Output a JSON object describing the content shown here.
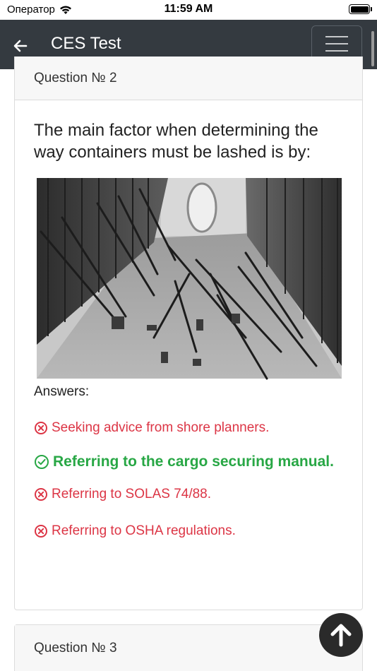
{
  "status_bar": {
    "carrier": "Оператор",
    "time": "11:59 AM"
  },
  "navbar": {
    "title": "CES Test"
  },
  "question": {
    "header": "Question № 2",
    "text": "The main factor when determining the way containers must be lashed is by:",
    "answers_label": "Answers:",
    "answers": [
      {
        "text": "Seeking advice from shore planners.",
        "correct": false
      },
      {
        "text": "Referring to the cargo securing manual.",
        "correct": true
      },
      {
        "text": "Referring to SOLAS 74/88.",
        "correct": false
      },
      {
        "text": "Referring to OSHA regulations.",
        "correct": false
      }
    ]
  },
  "next_question": {
    "header": "Question № 3"
  },
  "colors": {
    "navbar": "#343a40",
    "wrong": "#dc3545",
    "correct": "#28a745"
  },
  "icons": [
    "wifi-icon",
    "battery-icon",
    "back-arrow-icon",
    "menu-icon",
    "x-circle-icon",
    "check-circle-icon",
    "arrow-up-circle-icon"
  ]
}
